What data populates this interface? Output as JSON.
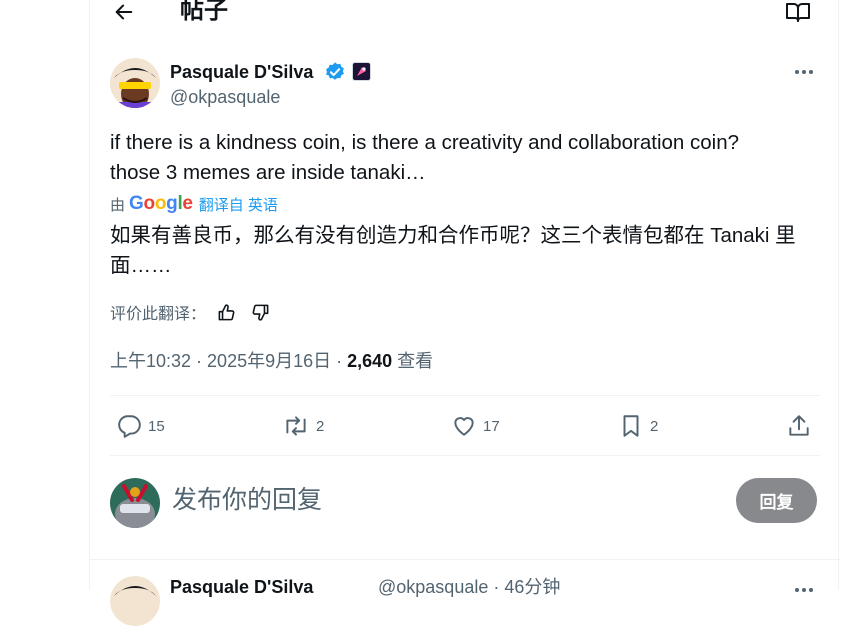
{
  "header": {
    "title": "帖子"
  },
  "post": {
    "author": {
      "name": "Pasquale D'Silva",
      "handle": "@okpasquale"
    },
    "text": "if there is a kindness coin, is there a creativity and collaboration coin?\nthose 3 memes are inside tanaki…",
    "translation": {
      "by_prefix": "由",
      "provider": "Google",
      "link_label": "翻译自 英语",
      "text": "如果有善良币，那么有没有创造力和合作币呢？这三个表情包都在 Tanaki 里面……",
      "rate_label": "评价此翻译："
    },
    "meta": {
      "time": "上午10:32",
      "sep1": " · ",
      "date": "2025年9月16日",
      "sep2": " · ",
      "views": "2,640",
      "views_label": " 查看"
    },
    "actions": {
      "replies": "15",
      "reposts": "2",
      "likes": "17",
      "bookmarks": "2"
    }
  },
  "composer": {
    "placeholder": "发布你的回复",
    "button_label": "回复"
  },
  "next_reply": {
    "author_name": "Pasquale D'Silva",
    "handle_time": "@okpasquale · 46分钟"
  },
  "colors": {
    "verified": "#1d9bf0",
    "link": "#1d9bf0",
    "secondary_text": "#536471",
    "reply_button": "#87898c"
  }
}
